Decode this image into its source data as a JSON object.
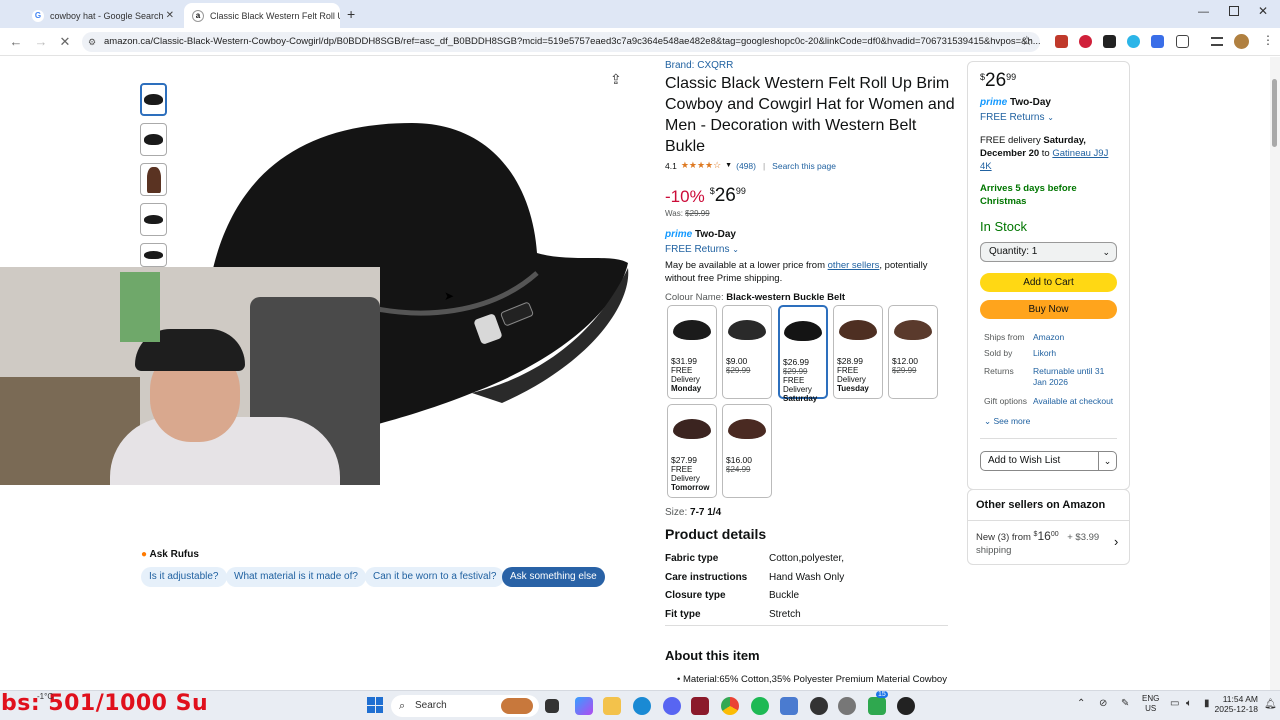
{
  "browser": {
    "tabs": [
      {
        "label": "cowboy hat - Google Search",
        "favicon": "G"
      },
      {
        "label": "Classic Black Western Felt Roll U",
        "favicon": "a"
      }
    ],
    "new_tab": "+",
    "url": "amazon.ca/Classic-Black-Western-Cowboy-Cowgirl/dp/B0BDDH8SGB/ref=asc_df_B0BDDH8SGB?mcid=519e5757eaed3c7a9c364e548ae482e8&tag=googleshopc0c-20&linkCode=df0&hvadid=706731539415&hvpos=&h..."
  },
  "product": {
    "brand": "Brand: CXQRR",
    "title": "Classic Black Western Felt Roll Up Brim Cowboy and Cowgirl Hat for Women and Men - Decoration with Western Belt Bukle",
    "rating": "4.1",
    "stars": 4.1,
    "reviews": "(498)",
    "sep": "|",
    "search_page": "Search this page",
    "discount": "-10%",
    "price_sym": "$",
    "price_main": "26",
    "price_cents": "99",
    "was_label": "Was:",
    "was_price": "$29.99",
    "prime": "prime",
    "two_day": "Two-Day",
    "free_returns": "FREE Returns",
    "avail_pre": "May be available at a lower price from ",
    "avail_link": "other sellers",
    "avail_post": ", potentially without free Prime shipping.",
    "colour_label": "Colour Name:",
    "colour_value": "Black-western Buckle Belt",
    "swatches": [
      {
        "price": "$31.99",
        "was": "",
        "delivery": "FREE Delivery",
        "day": "Monday",
        "color": "#1b1b1b"
      },
      {
        "price": "$9.00",
        "was": "$29.99",
        "delivery": "",
        "day": "",
        "color": "#2a2a2a"
      },
      {
        "price": "$26.99",
        "was": "$29.99",
        "delivery": "FREE Delivery",
        "day": "Saturday",
        "color": "#141414"
      },
      {
        "price": "$28.99",
        "was": "",
        "delivery": "FREE Delivery",
        "day": "Tuesday",
        "color": "#4e2f22"
      },
      {
        "price": "$12.00",
        "was": "$29.99",
        "delivery": "",
        "day": "",
        "color": "#5a3a2c"
      },
      {
        "price": "$27.99",
        "was": "",
        "delivery": "FREE Delivery",
        "day": "Tomorrow",
        "color": "#3b2420"
      },
      {
        "price": "$16.00",
        "was": "$24.99",
        "delivery": "",
        "day": "",
        "color": "#4a2a22"
      }
    ],
    "size_label": "Size:",
    "size_value": "7-7 1/4",
    "details_heading": "Product details",
    "details": [
      {
        "k": "Fabric type",
        "v": "Cotton,polyester,"
      },
      {
        "k": "Care instructions",
        "v": "Hand Wash Only"
      },
      {
        "k": "Closure type",
        "v": "Buckle"
      },
      {
        "k": "Fit type",
        "v": "Stretch"
      }
    ],
    "about_heading": "About this item",
    "about_first": "Material:65% Cotton,35% Polyester Premium Material Cowboy"
  },
  "rufus": {
    "label": "Ask Rufus",
    "chips": [
      "Is it adjustable?",
      "What material is it made of?",
      "Can it be worn to a festival?"
    ],
    "ask_else": "Ask something else"
  },
  "buybox": {
    "price_sym": "$",
    "price_main": "26",
    "price_cents": "99",
    "prime": "prime",
    "two_day": "Two-Day",
    "free_returns": "FREE Returns",
    "delivery_pre": "FREE delivery ",
    "delivery_day": "Saturday, December 20",
    "delivery_to": " to ",
    "location": "Gatineau J9J 4K",
    "arrives": "Arrives 5 days before Christmas",
    "stock": "In Stock",
    "quantity": "Quantity:  1",
    "add_cart": "Add to Cart",
    "buy_now": "Buy Now",
    "info": [
      {
        "k": "Ships from",
        "v": "Amazon"
      },
      {
        "k": "Sold by",
        "v": "Likorh"
      },
      {
        "k": "Returns",
        "v": "Returnable until 31 Jan 2026"
      },
      {
        "k": "Gift options",
        "v": "Available at checkout"
      }
    ],
    "see_more": "See more",
    "wishlist": "Add to Wish List",
    "other_heading": "Other sellers on Amazon",
    "other_new": "New (3) from ",
    "other_price_sym": "$",
    "other_price_main": "16",
    "other_price_cents": "00",
    "other_ship": "+ $3.99",
    "other_ship2": "shipping"
  },
  "overlay": {
    "counter": "bs: 501/1000  Su",
    "temp": "-1°C"
  },
  "taskbar": {
    "search": "Search",
    "lang1": "ENG",
    "lang2": "US",
    "time": "11:54 AM",
    "date": "2025-12-18",
    "badge": "15"
  },
  "colors": {
    "accent": "#2162a1",
    "prime": "#1399ff",
    "deal": "#cc0c39",
    "stock": "#007600",
    "cart": "#ffd814",
    "buy": "#ffa41c"
  }
}
